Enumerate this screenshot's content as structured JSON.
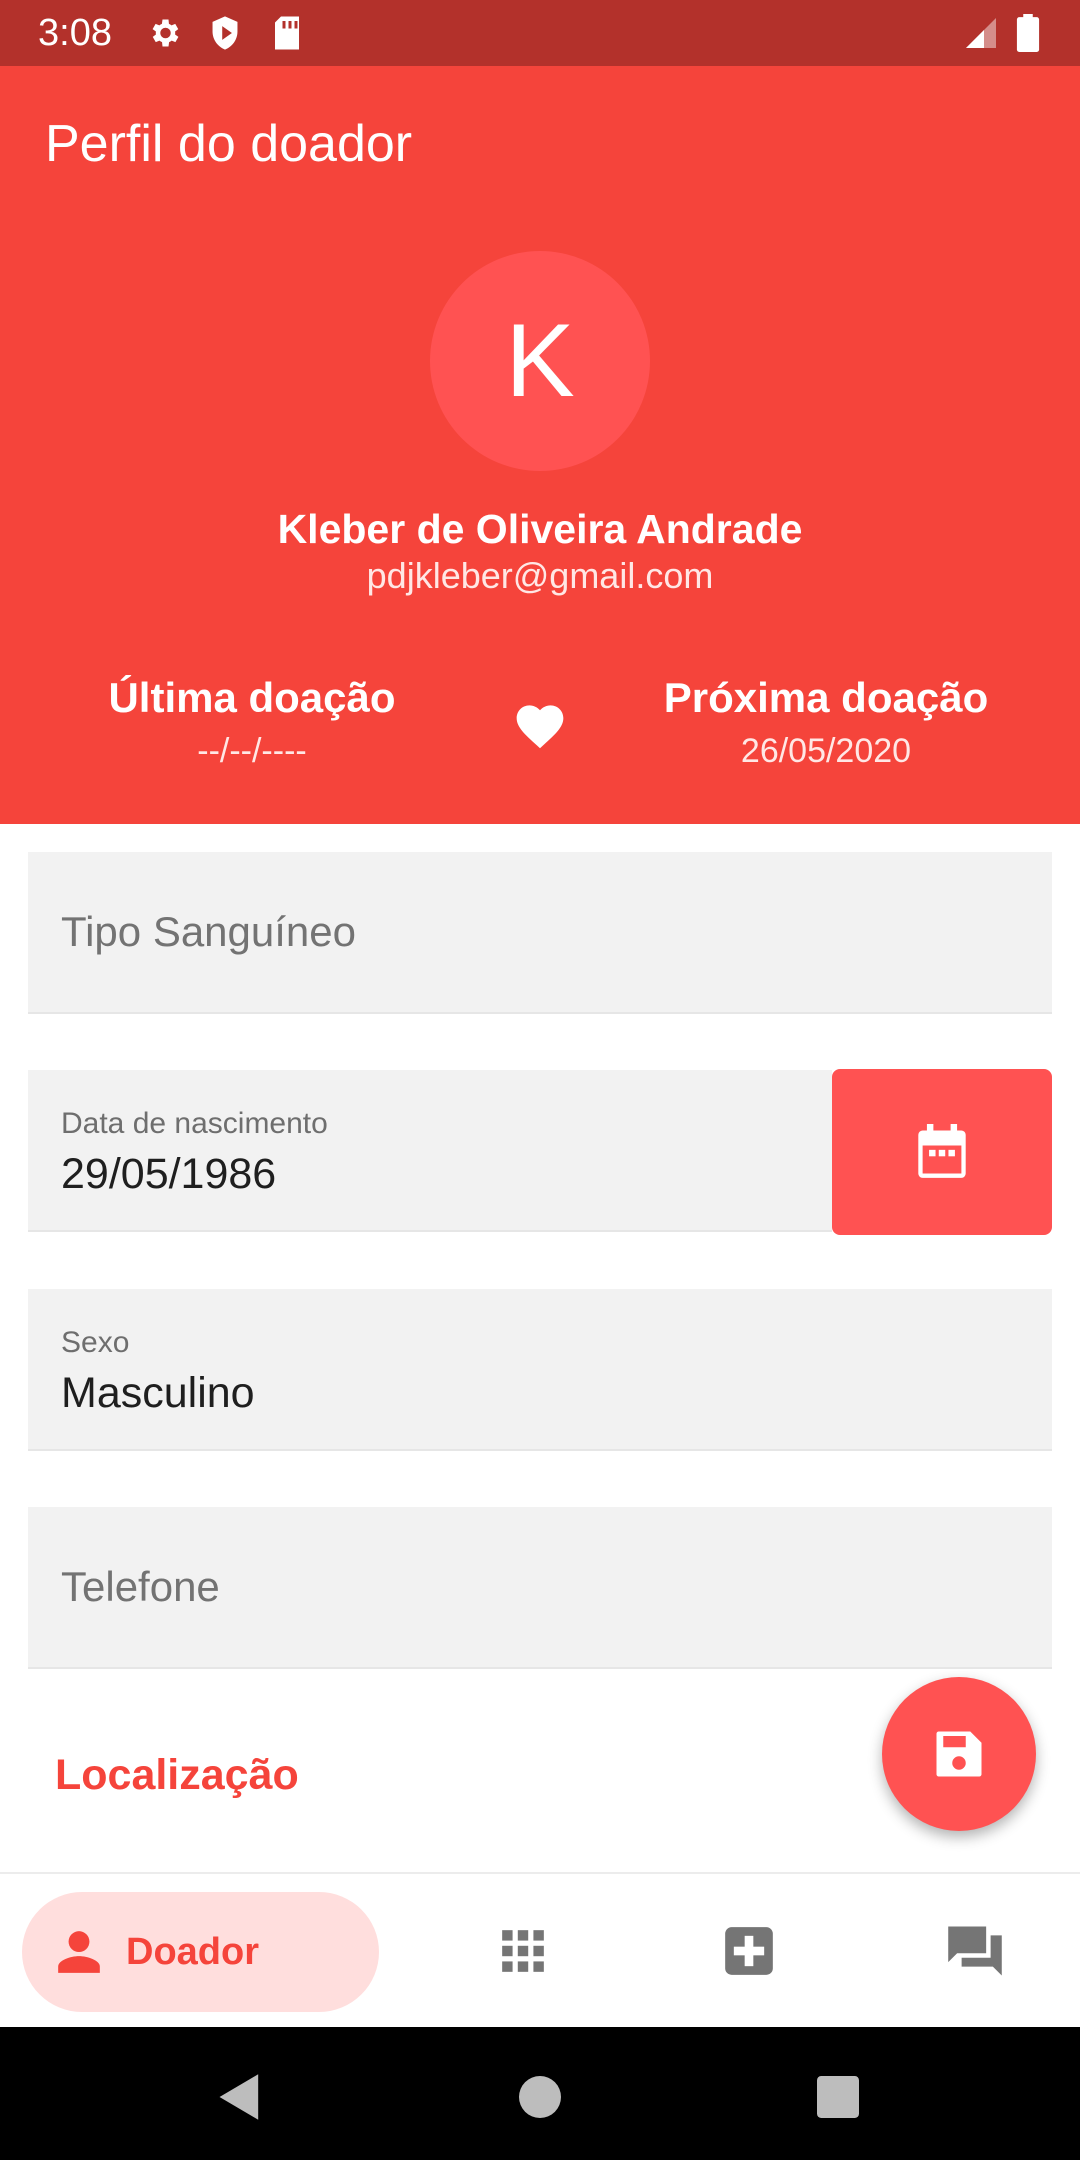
{
  "status_bar": {
    "time": "3:08",
    "left_icons": [
      "gear-icon",
      "shield-icon",
      "sd-card-icon"
    ],
    "right_icons": [
      "signal-icon",
      "battery-icon"
    ]
  },
  "header": {
    "title": "Perfil do doador",
    "avatar_initial": "K",
    "user_name": "Kleber de Oliveira Andrade",
    "user_email": "pdjkleber@gmail.com",
    "last_donation": {
      "label": "Última doação",
      "value": "--/--/----"
    },
    "next_donation": {
      "label": "Próxima doação",
      "value": "26/05/2020"
    }
  },
  "form": {
    "blood_type": {
      "placeholder": "Tipo Sanguíneo"
    },
    "birth_date": {
      "label": "Data de nascimento",
      "value": "29/05/1986"
    },
    "sex": {
      "label": "Sexo",
      "value": "Masculino"
    },
    "phone": {
      "placeholder": "Telefone"
    },
    "location_label": "Localização"
  },
  "bottom_nav": {
    "active_label": "Doador",
    "items": [
      "person-icon",
      "grid-icon",
      "medical-plus-icon",
      "chat-icon"
    ]
  },
  "colors": {
    "primary": "#f5443b",
    "status_bar": "#b3312b",
    "accent": "#ff5252",
    "nav_pill": "#ffdedd",
    "field_bg": "#f2f2f2"
  }
}
